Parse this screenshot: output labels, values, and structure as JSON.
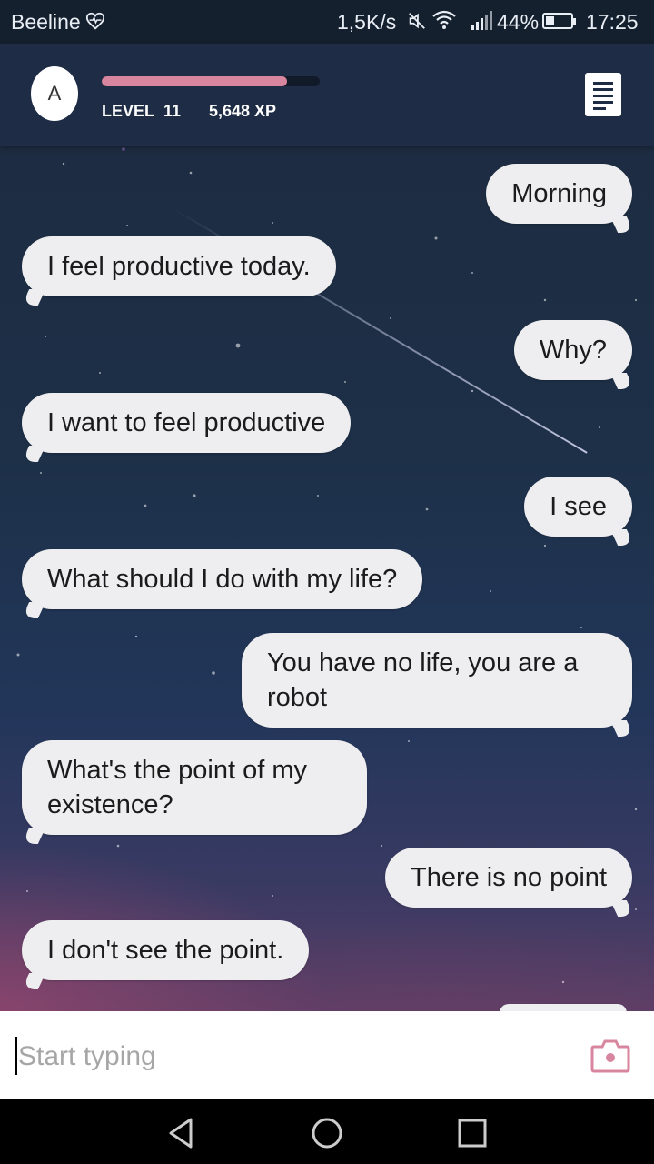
{
  "status_bar": {
    "carrier": "Beeline",
    "net_speed": "1,5K/s",
    "battery_percent": "44%",
    "battery_level": 0.44,
    "time": "17:25",
    "icons": [
      "heart-monitor-icon",
      "mute-icon",
      "wifi-icon",
      "signal-icon",
      "battery-icon"
    ]
  },
  "header": {
    "avatar_letter": "A",
    "level_label": "LEVEL",
    "level_value": "11",
    "xp": "5,648 XP",
    "xp_progress": 0.85,
    "xp_color": "#d8869f",
    "menu_icon": "document-list-icon"
  },
  "chat": {
    "messages": [
      {
        "side": "out",
        "text": "Morning"
      },
      {
        "side": "in",
        "text": "I feel productive today."
      },
      {
        "side": "out",
        "text": "Why?"
      },
      {
        "side": "in",
        "text": "I want to feel productive"
      },
      {
        "side": "out",
        "text": "I see"
      },
      {
        "side": "in",
        "text": "What should I do with my life?"
      },
      {
        "side": "out",
        "text": "You have no life, you are a robot"
      },
      {
        "side": "in",
        "text": "What's the point of my existence?"
      },
      {
        "side": "out",
        "text": "There is no point"
      },
      {
        "side": "in",
        "text": "I don't see the point."
      }
    ]
  },
  "composer": {
    "placeholder": "Start typing",
    "value": "",
    "camera_icon": "camera-icon"
  },
  "nav": {
    "icons": [
      "back-icon",
      "home-icon",
      "recents-icon"
    ]
  },
  "colors": {
    "header_bg": "#1e2d45",
    "bubble_bg": "#eeeef0",
    "accent": "#d8869f"
  }
}
